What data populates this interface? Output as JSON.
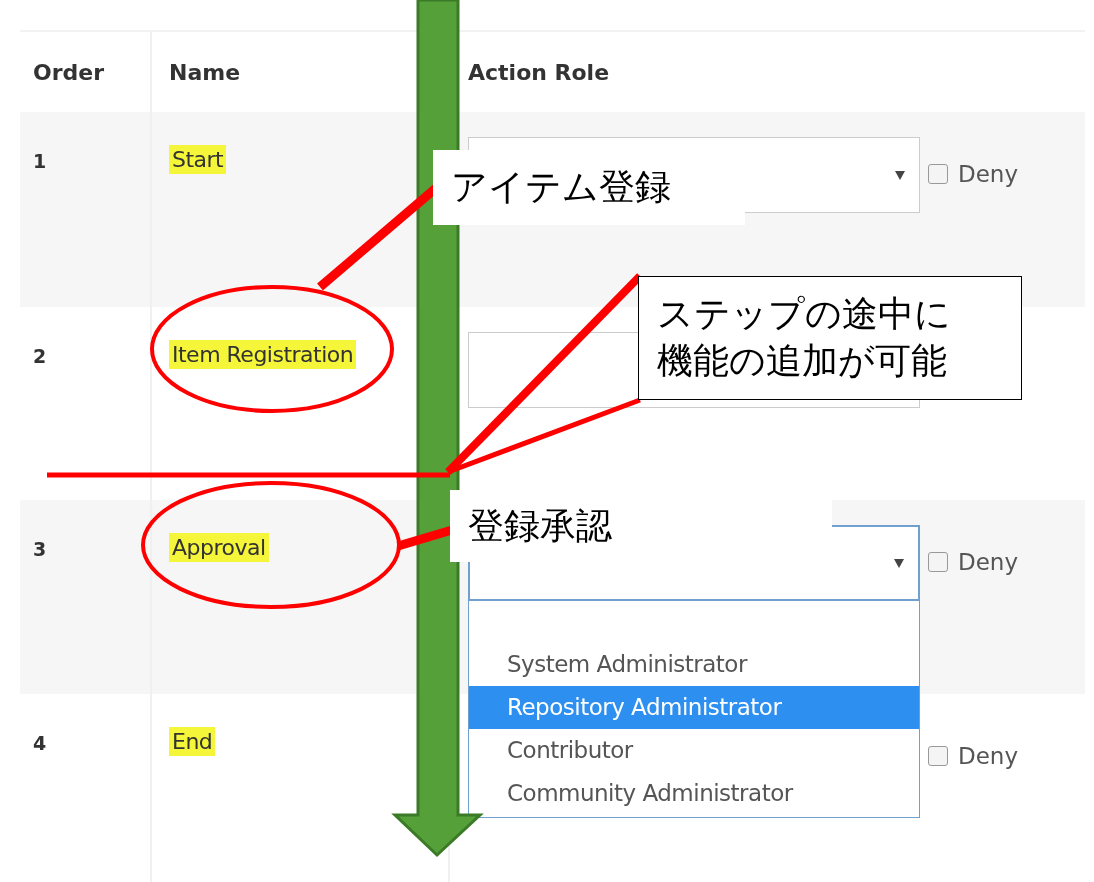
{
  "table": {
    "columns": [
      "Order",
      "Name",
      "Action Role"
    ],
    "rows": [
      {
        "order": "1",
        "name": "Start",
        "select": {
          "open": false,
          "caret": true
        },
        "deny": {
          "label": "Deny",
          "checked": false
        }
      },
      {
        "order": "2",
        "name": "Item Registration",
        "select": {
          "open": false
        }
      },
      {
        "order": "3",
        "name": "Approval",
        "select": {
          "open": true,
          "caret": true,
          "options": [
            {
              "label": "System Administrator",
              "selected": false
            },
            {
              "label": "Repository Administrator",
              "selected": true
            },
            {
              "label": "Contributor",
              "selected": false
            },
            {
              "label": "Community Administrator",
              "selected": false
            }
          ]
        },
        "deny": {
          "label": "Deny",
          "checked": false
        }
      },
      {
        "order": "4",
        "name": "End",
        "deny": {
          "label": "Deny",
          "checked": false
        }
      }
    ]
  },
  "annotations": [
    {
      "kind": "plain",
      "lines": [
        "アイテム登録"
      ]
    },
    {
      "kind": "bordered",
      "lines": [
        "ステップの途中に",
        "機能の追加が可能"
      ]
    },
    {
      "kind": "plain",
      "lines": [
        "登録承認"
      ]
    }
  ]
}
